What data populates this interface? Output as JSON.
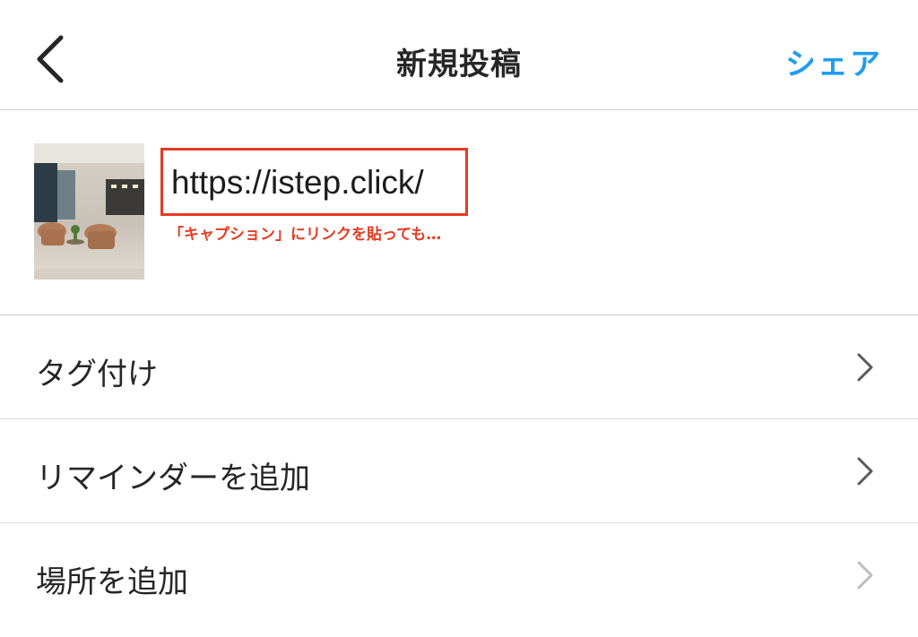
{
  "header": {
    "title": "新規投稿",
    "share_label": "シェア",
    "back_icon": "chevron-left-icon"
  },
  "compose": {
    "caption_value": "https://istep.click/",
    "annotation": "「キャプション」にリンクを貼っても…"
  },
  "menu": {
    "items": [
      {
        "label": "タグ付け",
        "icon": "chevron-right-icon"
      },
      {
        "label": "リマインダーを追加",
        "icon": "chevron-right-icon"
      },
      {
        "label": "場所を追加",
        "icon": "chevron-right-icon"
      }
    ]
  },
  "colors": {
    "accent": "#1f9cee",
    "highlight": "#e53b22",
    "text": "#262626",
    "divider": "#cfcfcf"
  }
}
